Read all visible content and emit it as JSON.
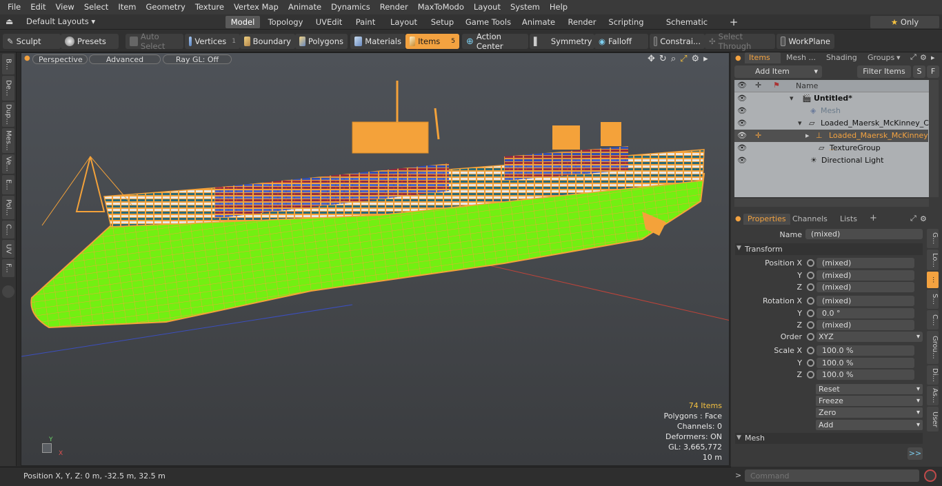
{
  "menu": [
    "File",
    "Edit",
    "View",
    "Select",
    "Item",
    "Geometry",
    "Texture",
    "Vertex Map",
    "Animate",
    "Dynamics",
    "Render",
    "MaxToModo",
    "Layout",
    "System",
    "Help"
  ],
  "layout_bar": {
    "layouts_label": "Default Layouts",
    "tabs": [
      "Model",
      "Topology",
      "UVEdit",
      "Paint",
      "Layout",
      "Setup",
      "Game Tools",
      "Animate",
      "Render",
      "Scripting",
      "Schematic Fusion"
    ],
    "active_tab": "Model",
    "add_label": "+",
    "only_label": "Only"
  },
  "toolbar": {
    "sculpt": "Sculpt",
    "presets": "Presets",
    "auto_select": "Auto Select",
    "vertices": "Vertices",
    "vertices_count": "1",
    "boundary": "Boundary",
    "polygons": "Polygons",
    "materials": "Materials",
    "items": "Items",
    "items_count": "5",
    "action_center": "Action Center",
    "symmetry": "Symmetry",
    "falloff": "Falloff",
    "constraints": "Constrai...",
    "select_through": "Select Through",
    "workplane": "WorkPlane"
  },
  "left_tabs": [
    "B...",
    "De...",
    "Dup...",
    "Mes...",
    "Ve...",
    "E...",
    "Pol...",
    "C...",
    "UV",
    "F..."
  ],
  "viewport": {
    "perspective": "Perspective",
    "advanced": "Advanced",
    "raygl": "Ray GL: Off",
    "stats": {
      "items": "74 Items",
      "polygons": "Polygons : Face",
      "channels": "Channels: 0",
      "deformers": "Deformers: ON",
      "gl": "GL: 3,665,772",
      "scale": "10 m"
    },
    "axis": {
      "y": "Y",
      "x": "X"
    }
  },
  "status": {
    "position": "Position X, Y, Z:   0 m, -32.5 m, 32.5 m"
  },
  "items_panel": {
    "tabs": [
      "Items",
      "Mesh ...",
      "Shading",
      "Groups"
    ],
    "add_item": "Add Item",
    "filter_items": "Filter Items",
    "s_btn": "S",
    "f_btn": "F",
    "name_header": "Name",
    "tree": [
      {
        "label": "Untitled*"
      },
      {
        "label": "Mesh"
      },
      {
        "label": "Loaded_Maersk_McKinney_C ..."
      },
      {
        "label": "Loaded_Maersk_McKinney ..."
      },
      {
        "label": "TextureGroup"
      },
      {
        "label": "Directional Light"
      }
    ]
  },
  "properties": {
    "tabs": [
      "Properties",
      "Channels",
      "Lists"
    ],
    "add_tab": "+",
    "name_label": "Name",
    "name_value": "(mixed)",
    "transform_header": "Transform",
    "position": [
      {
        "label": "Position X",
        "value": "(mixed)"
      },
      {
        "label": "Y",
        "value": "(mixed)"
      },
      {
        "label": "Z",
        "value": "(mixed)"
      }
    ],
    "rotation": [
      {
        "label": "Rotation X",
        "value": "(mixed)"
      },
      {
        "label": "Y",
        "value": "0.0 °"
      },
      {
        "label": "Z",
        "value": "(mixed)"
      }
    ],
    "order_label": "Order",
    "order_value": "XYZ",
    "scale": [
      {
        "label": "Scale X",
        "value": "100.0 %"
      },
      {
        "label": "Y",
        "value": "100.0 %"
      },
      {
        "label": "Z",
        "value": "100.0 %"
      }
    ],
    "actions": [
      "Reset",
      "Freeze",
      "Zero",
      "Add"
    ],
    "mesh_header": "Mesh",
    "expand": ">>"
  },
  "right_tabs": [
    "G...",
    "Lo...",
    "...",
    "S...",
    "C...",
    "Grou...",
    "Di...",
    "As...",
    "User"
  ],
  "command": {
    "placeholder": "Command",
    "prompt": ">"
  },
  "colors": {
    "accent": "#f3a240",
    "mesh_green": "#7dff1f",
    "wire_orange": "#f4a23a"
  }
}
